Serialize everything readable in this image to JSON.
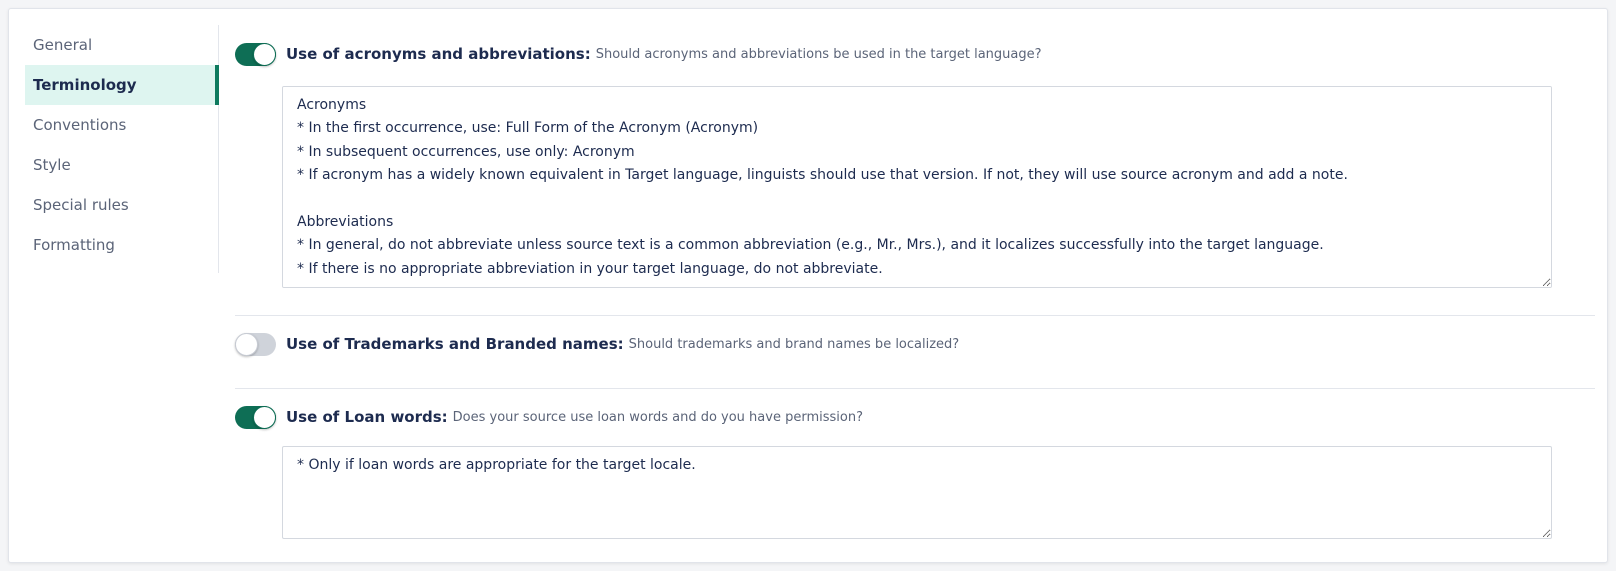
{
  "sidebar": {
    "items": [
      {
        "label": "General"
      },
      {
        "label": "Terminology",
        "active": true
      },
      {
        "label": "Conventions"
      },
      {
        "label": "Style"
      },
      {
        "label": "Special rules"
      },
      {
        "label": "Formatting"
      }
    ]
  },
  "sections": [
    {
      "toggle_on": true,
      "title": "Use of acronyms and abbreviations:",
      "description": "Should acronyms and abbreviations be used in the target language?",
      "value": "Acronyms\n* In the first occurrence, use: Full Form of the Acronym (Acronym)\n* In subsequent occurrences, use only: Acronym\n* If acronym has a widely known equivalent in Target language, linguists should use that version. If not, they will use source acronym and add a note.\n\nAbbreviations\n* In general, do not abbreviate unless source text is a common abbreviation (e.g., Mr., Mrs.), and it localizes successfully into the target language.\n* If there is no appropriate abbreviation in your target language, do not abbreviate."
    },
    {
      "toggle_on": false,
      "title": "Use of Trademarks and Branded names:",
      "description": "Should trademarks and brand names be localized?"
    },
    {
      "toggle_on": true,
      "title": "Use of Loan words:",
      "description": "Does your source use loan words and do you have permission?",
      "value": "* Only if loan words are appropriate for the target locale."
    }
  ],
  "colors": {
    "accent": "#0e6e55",
    "active_bg": "#def5f0",
    "text": "#1d2b4f",
    "muted": "#5b6478"
  }
}
